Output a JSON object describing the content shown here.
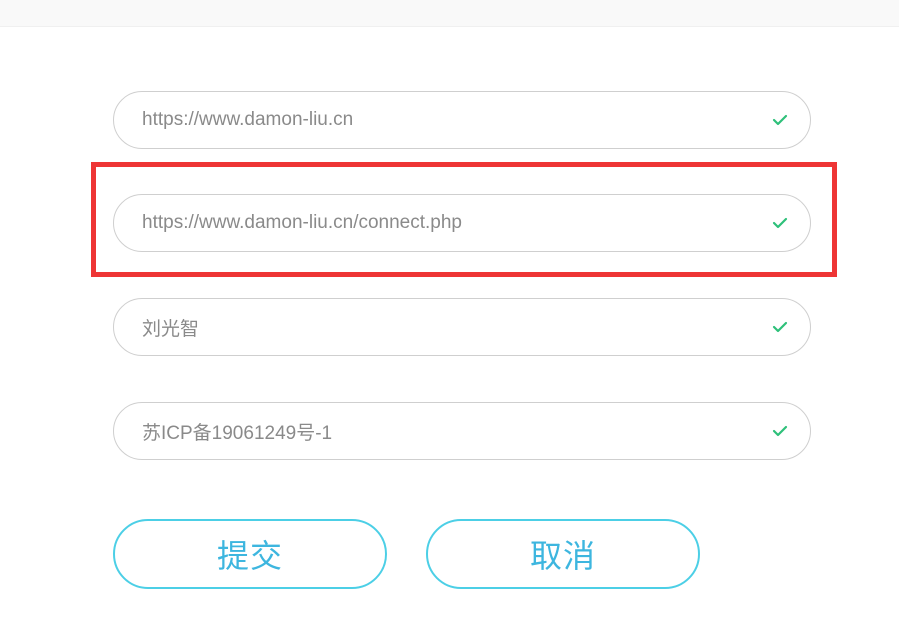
{
  "form": {
    "fields": [
      {
        "value": "https://www.damon-liu.cn",
        "status_icon": "check-icon"
      },
      {
        "value": "https://www.damon-liu.cn/connect.php",
        "status_icon": "check-icon"
      },
      {
        "value": "刘光智",
        "status_icon": "check-icon"
      },
      {
        "value": "苏ICP备19061249号-1",
        "status_icon": "check-icon"
      }
    ]
  },
  "buttons": {
    "submit_label": "提交",
    "cancel_label": "取消"
  },
  "colors": {
    "valid_check": "#2ec07a",
    "highlight": "#ee3535",
    "button_accent": "#3db6df",
    "field_border": "#cfcfcf"
  }
}
